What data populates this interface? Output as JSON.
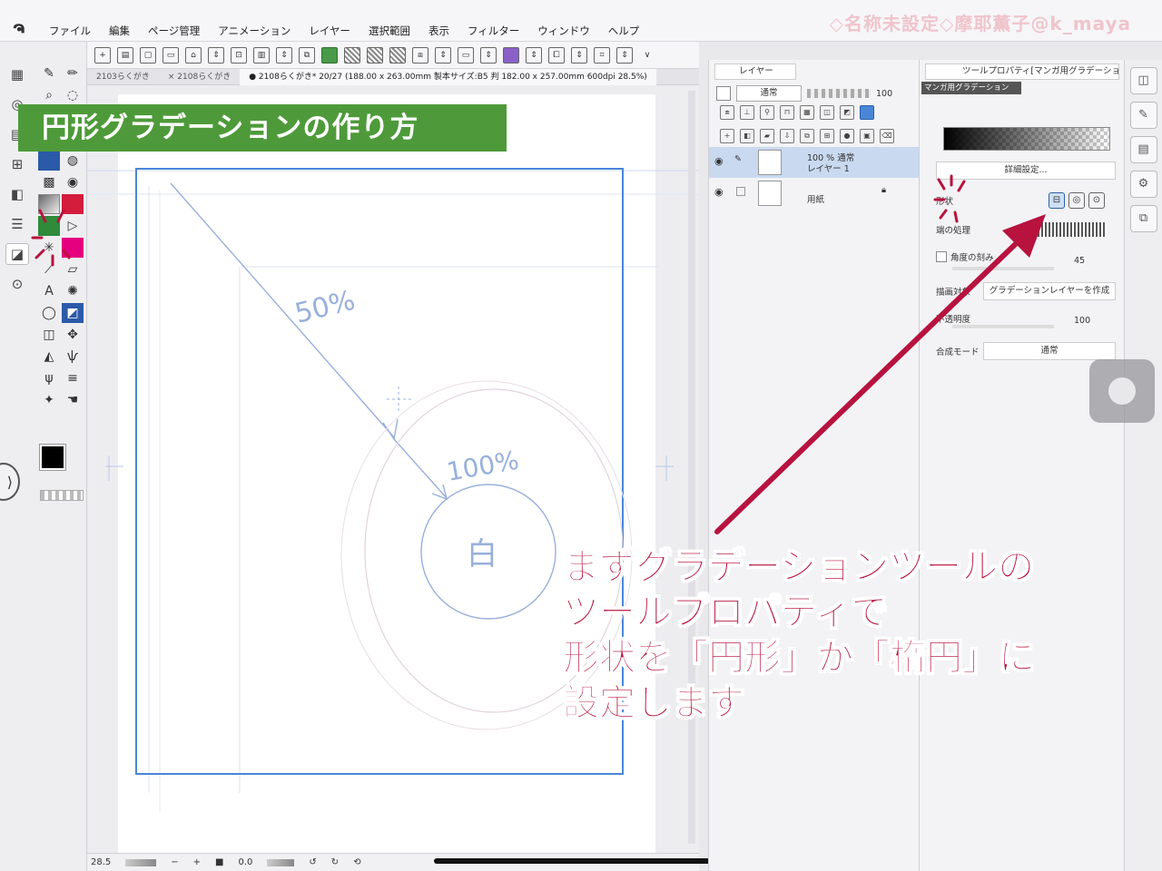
{
  "app": {
    "logo": "ຈ",
    "menus": [
      "ファイル",
      "編集",
      "ページ管理",
      "アニメーション",
      "レイヤー",
      "選択範囲",
      "表示",
      "フィルター",
      "ウィンドウ",
      "ヘルプ"
    ],
    "watermark": "◇名称未設定◇摩耶薫子@k_maya"
  },
  "tabs": [
    {
      "label": "2103らくがき"
    },
    {
      "label": "× 2108らくがき"
    },
    {
      "label": "● 2108らくがき* 20/27 (188.00 x 263.00mm 製本サイズ:B5 判 182.00 x 257.00mm 600dpi 28.5%)"
    }
  ],
  "banner": {
    "title": "円形グラデーションの作り方"
  },
  "sketch": {
    "text_top": "50%",
    "text_mid": "100%",
    "text_center": "白"
  },
  "status": {
    "zoom": "28.5",
    "minus": "−",
    "plus": "+",
    "angle": "0.0"
  },
  "layers": {
    "tab_label": "レイヤー",
    "blend_mode": "通常",
    "opacity": "100",
    "items": [
      {
        "line1": "100 %  通常",
        "line2": "レイヤー 1",
        "active": true
      },
      {
        "line1": "",
        "line2": "用紙",
        "active": false
      }
    ]
  },
  "tool_property": {
    "tab_label": "ツールプロパティ[マンガ用グラデーション]",
    "sub_tool_name": "マンガ用グラデーション",
    "detail_button": "詳細設定...",
    "shape_label": "形状",
    "edge_label": "端の処理",
    "angle_step_label": "角度の刻み",
    "angle_step_value": "45",
    "draw_target_label": "描画対象",
    "draw_target_value": "グラデーションレイヤーを作成",
    "opacity_label": "不透明度",
    "opacity_value": "100",
    "blend_label": "合成モード",
    "blend_value": "通常"
  },
  "annotation": {
    "lines": [
      "まずグラデーションツールの",
      "ツールプロパティで",
      "形状を「円形」か「楕円」に",
      "設定します"
    ],
    "color": "#b8123e"
  },
  "colors": {
    "banner_bg": "#4e9a3a",
    "selection_blue": "#4a86d8",
    "accent_red": "#b8123e"
  }
}
